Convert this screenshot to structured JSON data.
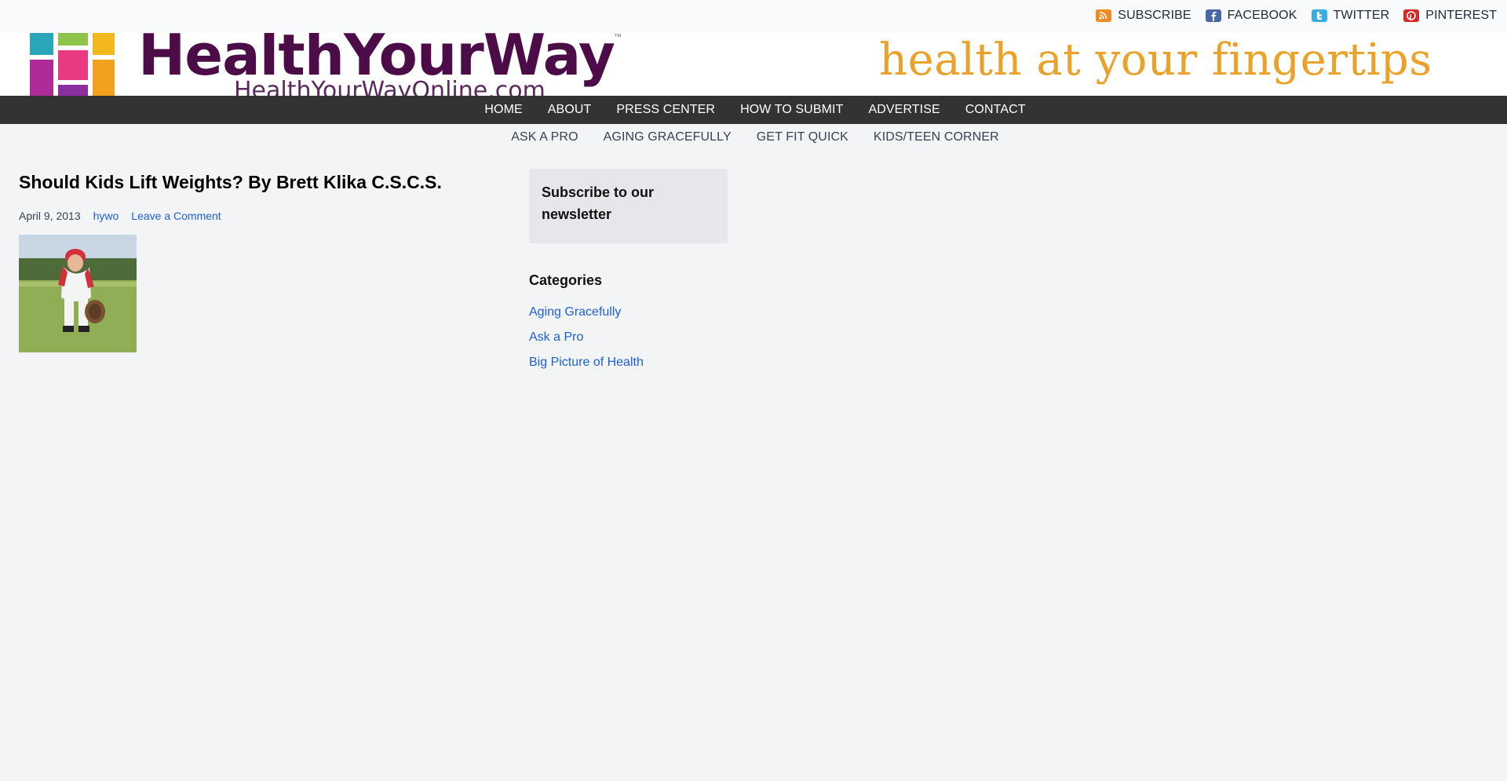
{
  "social": [
    {
      "label": "SUBSCRIBE",
      "icon": "rss-icon"
    },
    {
      "label": "FACEBOOK",
      "icon": "facebook-icon"
    },
    {
      "label": "TWITTER",
      "icon": "twitter-icon"
    },
    {
      "label": "PINTEREST",
      "icon": "pinterest-icon"
    }
  ],
  "banner": {
    "logo_text": "HealthYourWay",
    "logo_tm": "™",
    "logo_sub": "HealthYourWayOnline.com",
    "tagline": "health at your fingertips",
    "brand_color": "#4c0c48",
    "tagline_color": "#eba22a"
  },
  "primary_nav": [
    "HOME",
    "ABOUT",
    "PRESS CENTER",
    "HOW TO SUBMIT",
    "ADVERTISE",
    "CONTACT"
  ],
  "secondary_nav": [
    "ASK A PRO",
    "AGING GRACEFULLY",
    "GET FIT QUICK",
    "KIDS/TEEN CORNER"
  ],
  "article": {
    "title": "Should Kids Lift Weights? By Brett Klika C.S.C.S.",
    "date": "April 9, 2013",
    "author": "hywo",
    "comment_link": "Leave a Comment",
    "image_alt": "Child baseball player in a field"
  },
  "sidebar": {
    "newsletter_title": "Subscribe to our newsletter",
    "categories_title": "Categories",
    "categories": [
      "Aging Gracefully",
      "Ask a Pro",
      "Big Picture of Health"
    ]
  },
  "colors": {
    "link": "#1d5fd6",
    "nav_bg": "#333333",
    "page_bg": "#f3f4f6"
  }
}
